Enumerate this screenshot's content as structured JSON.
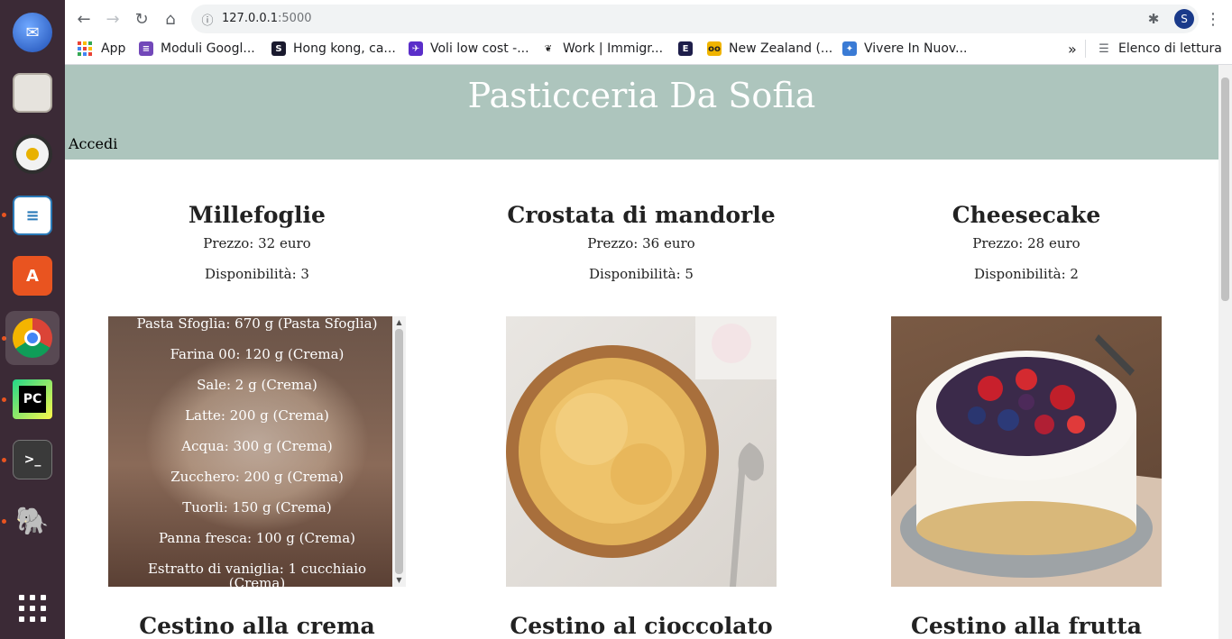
{
  "browser": {
    "url_host": "127.0.0.1",
    "url_port": ":5000",
    "profile_initial": "S",
    "bookmarks": [
      {
        "label": "App"
      },
      {
        "label": "Moduli Googl..."
      },
      {
        "label": "Hong kong, ca..."
      },
      {
        "label": "Voli low cost -..."
      },
      {
        "label": "Work | Immigr..."
      },
      {
        "label": ""
      },
      {
        "label": "New Zealand (..."
      },
      {
        "label": "Vivere In Nuov..."
      }
    ],
    "overflow_label": "»",
    "reading_list": "Elenco di lettura"
  },
  "site": {
    "title": "Pasticceria Da Sofia",
    "login": "Accedi"
  },
  "products": [
    {
      "name": "Millefoglie",
      "price": "Prezzo: 32 euro",
      "availability": "Disponibilità: 3"
    },
    {
      "name": "Crostata di mandorle",
      "price": "Prezzo: 36 euro",
      "availability": "Disponibilità: 5"
    },
    {
      "name": "Cheesecake",
      "price": "Prezzo: 28 euro",
      "availability": "Disponibilità: 2"
    },
    {
      "name": "Cestino alla crema"
    },
    {
      "name": "Cestino al cioccolato"
    },
    {
      "name": "Cestino alla frutta"
    }
  ],
  "ingredients": [
    "Pasta Sfoglia: 670 g (Pasta Sfoglia)",
    "Farina 00: 120 g (Crema)",
    "Sale: 2 g (Crema)",
    "Latte: 200 g (Crema)",
    "Acqua: 300 g (Crema)",
    "Zucchero: 200 g (Crema)",
    "Tuorli: 150 g (Crema)",
    "Panna fresca: 100 g (Crema)",
    "Estratto di vaniglia: 1 cucchiaio (Crema)"
  ],
  "colors": {
    "header_bg": "#adc5bd",
    "dock_bg": "#3b2a36"
  }
}
